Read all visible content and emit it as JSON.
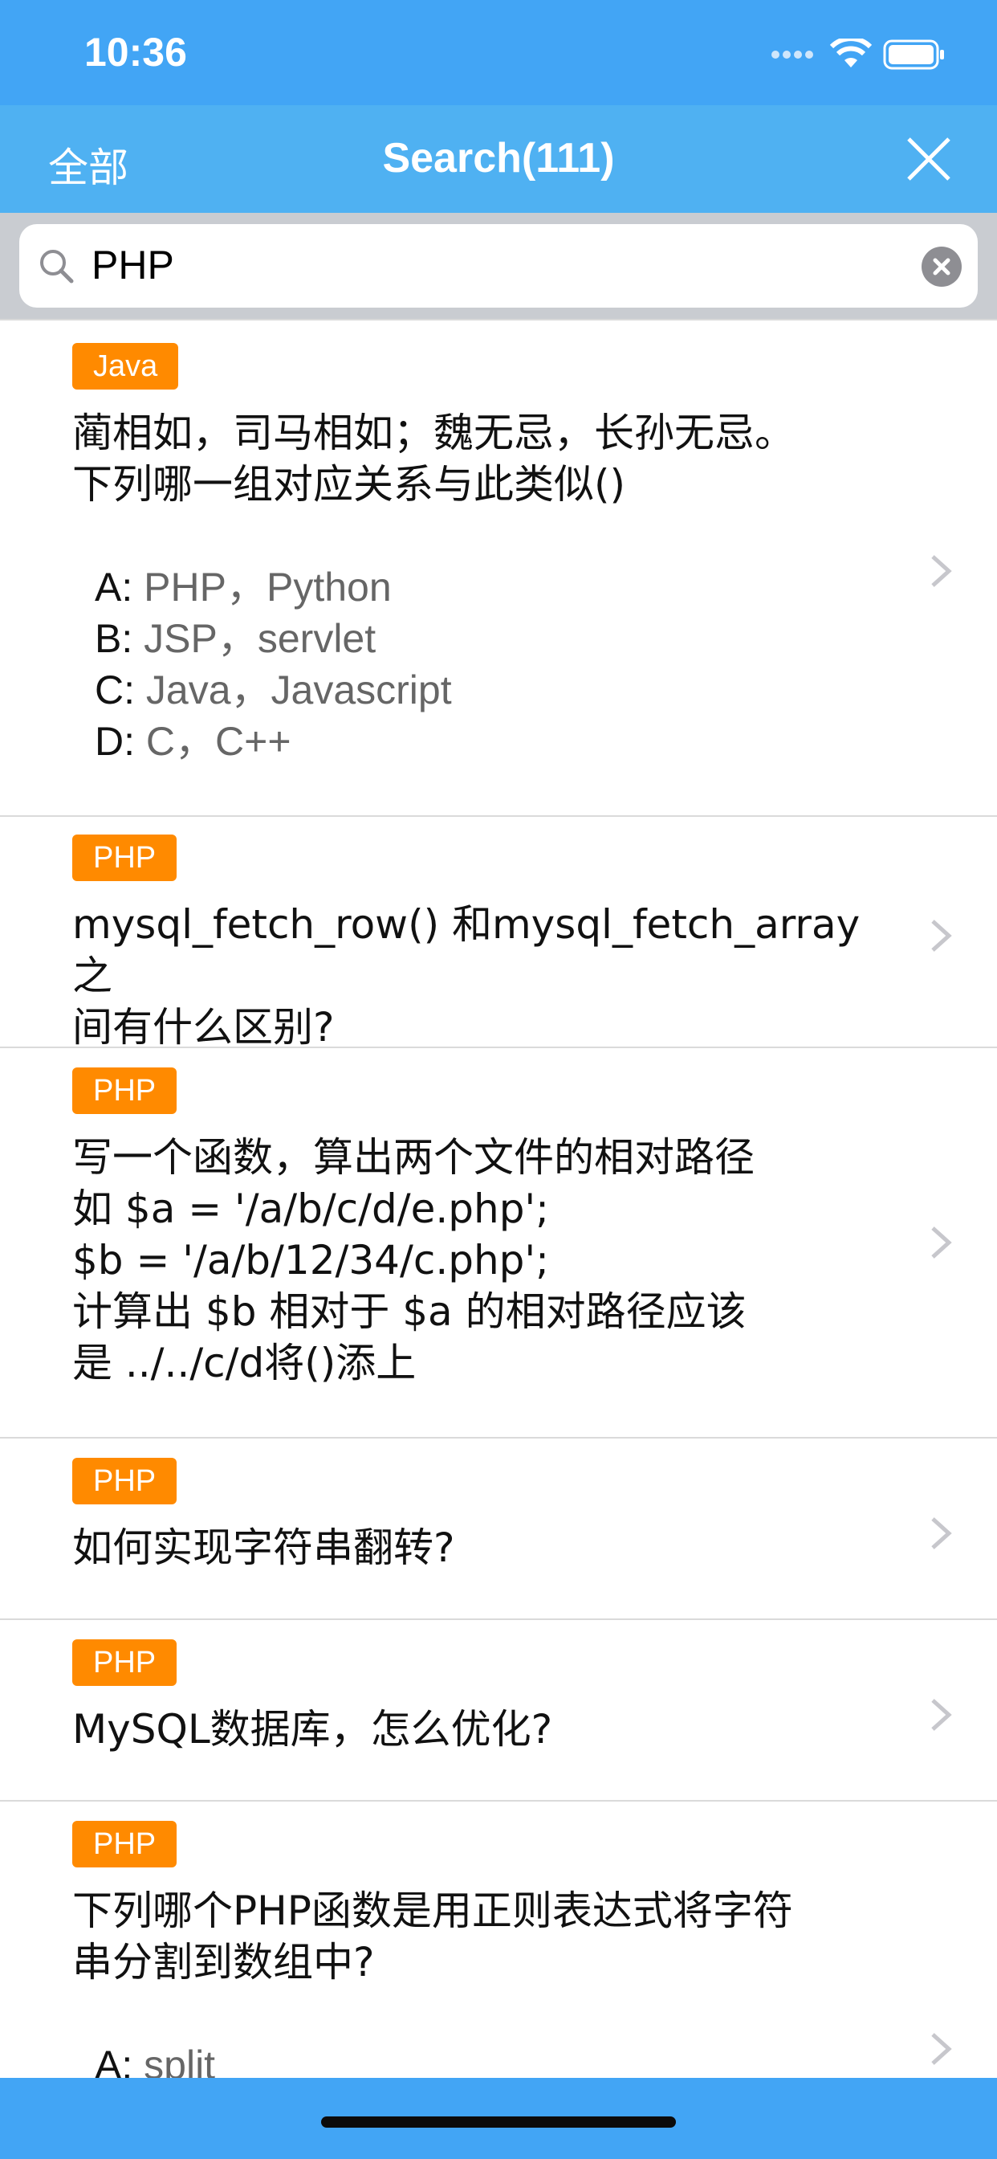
{
  "status_bar": {
    "time": "10:36"
  },
  "nav": {
    "left_label": "全部",
    "title": "Search(111)"
  },
  "search": {
    "query": "PHP"
  },
  "items": [
    {
      "tag": "Java",
      "question": "蔺相如，司马相如；魏无忌，长孙无忌。\n下列哪一组对应关系与此类似()",
      "options": [
        {
          "label": "A:",
          "text": "PHP，Python"
        },
        {
          "label": "B:",
          "text": "JSP，servlet"
        },
        {
          "label": "C:",
          "text": "Java，Javascript"
        },
        {
          "label": "D:",
          "text": "C，C++"
        }
      ]
    },
    {
      "tag": "PHP",
      "question": "mysql_fetch_row() 和mysql_fetch_array之\n间有什么区别?"
    },
    {
      "tag": "PHP",
      "question": "写一个函数，算出两个文件的相对路径\n如 $a = '/a/b/c/d/e.php';\n$b = '/a/b/12/34/c.php';\n计算出 $b 相对于 $a 的相对路径应该\n是 ../../c/d将()添上"
    },
    {
      "tag": "PHP",
      "question": "如何实现字符串翻转?"
    },
    {
      "tag": "PHP",
      "question": "MySQL数据库，怎么优化?"
    },
    {
      "tag": "PHP",
      "question": "下列哪个PHP函数是用正则表达式将字符\n串分割到数组中?",
      "options": [
        {
          "label": "A:",
          "text": "split"
        }
      ]
    }
  ],
  "colors": {
    "primary": "#42A5F5",
    "tag": "#FF8A00"
  }
}
